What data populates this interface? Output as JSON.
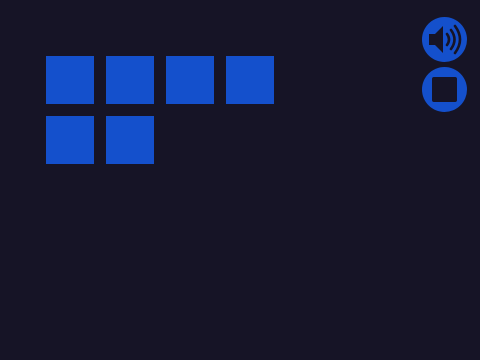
{
  "colors": {
    "background": "#161426",
    "tile": "#1450CC",
    "button": "#1450CC",
    "icon_dark": "#161426"
  },
  "grid": {
    "row_counts": [
      4,
      2
    ]
  },
  "controls": {
    "sound_icon": "speaker-volume-icon",
    "stop_icon": "stop-square-icon"
  }
}
